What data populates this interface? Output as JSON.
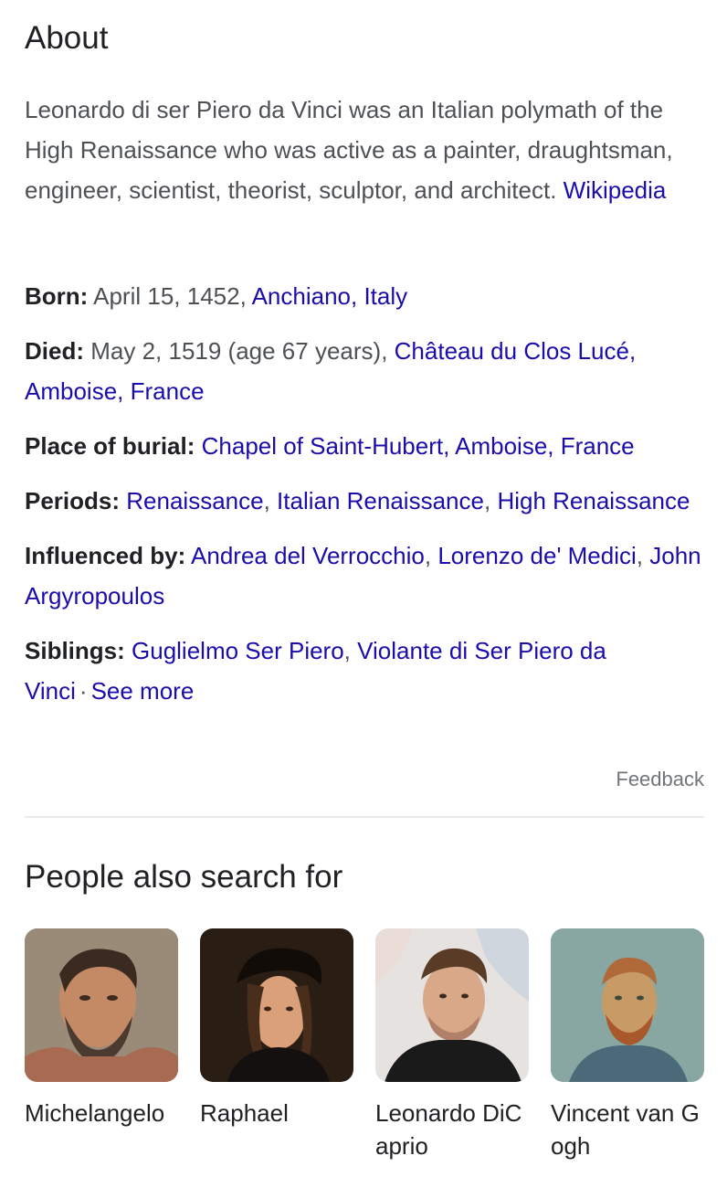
{
  "about": {
    "title": "About",
    "description": "Leonardo di ser Piero da Vinci was an Italian polymath of the High Renaissance who was active as a painter, draughtsman, engineer, scientist, theorist, sculptor, and architect.",
    "source_link": "Wikipedia"
  },
  "facts": {
    "born": {
      "label": "Born:",
      "text": "April 15, 1452,",
      "links": [
        "Anchiano, Italy"
      ]
    },
    "died": {
      "label": "Died:",
      "text": "May 2, 1519 (age 67 years),",
      "links": [
        "Château du Clos Lucé, Amboise, France"
      ]
    },
    "burial": {
      "label": "Place of burial:",
      "links": [
        "Chapel of Saint-Hubert, Amboise, France"
      ]
    },
    "periods": {
      "label": "Periods:",
      "links": [
        "Renaissance",
        "Italian Renaissance",
        "High Renaissance"
      ]
    },
    "influenced": {
      "label": "Influenced by:",
      "links": [
        "Andrea del Verrocchio",
        "Lorenzo de' Medici",
        "John Argyropoulos"
      ]
    },
    "siblings": {
      "label": "Siblings:",
      "links": [
        "Guglielmo Ser Piero",
        "Violante di Ser Piero da Vinci"
      ],
      "see_more": "See more"
    }
  },
  "feedback": "Feedback",
  "people_also_search": {
    "title": "People also search for",
    "items": [
      {
        "name": "Michelangelo",
        "image_icon": "portrait-michelangelo"
      },
      {
        "name": "Raphael",
        "image_icon": "portrait-raphael"
      },
      {
        "name": "Leonardo DiCaprio",
        "image_icon": "portrait-dicaprio"
      },
      {
        "name": "Vincent van Gogh",
        "image_icon": "portrait-van-gogh"
      }
    ]
  },
  "colors": {
    "link": "#1a0dab",
    "text": "#4d5156",
    "heading": "#202124",
    "muted": "#70757a",
    "divider": "#e8eaed"
  }
}
